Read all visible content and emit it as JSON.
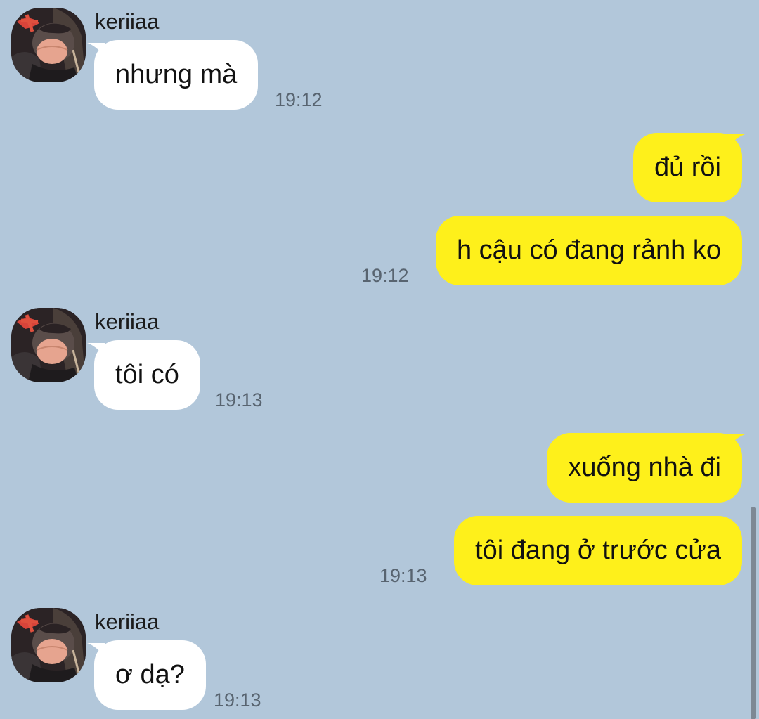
{
  "colors": {
    "background": "#b2c7da",
    "incoming_bubble": "#ffffff",
    "outgoing_bubble": "#fef01b",
    "timestamp": "#586470"
  },
  "messages": [
    {
      "direction": "in",
      "sender": "keriiaa",
      "text": "nhưng mà",
      "time": "19:12",
      "avatar": "avatar-photo"
    },
    {
      "direction": "out",
      "text": "đủ rồi"
    },
    {
      "direction": "out",
      "text": "h cậu có đang rảnh ko",
      "time": "19:12"
    },
    {
      "direction": "in",
      "sender": "keriiaa",
      "text": "tôi có",
      "time": "19:13",
      "avatar": "avatar-photo"
    },
    {
      "direction": "out",
      "text": "xuống nhà đi"
    },
    {
      "direction": "out",
      "text": "tôi đang ở trước cửa",
      "time": "19:13"
    },
    {
      "direction": "in",
      "sender": "keriiaa",
      "text": "ơ dạ?",
      "time": "19:13",
      "avatar": "avatar-photo"
    }
  ]
}
